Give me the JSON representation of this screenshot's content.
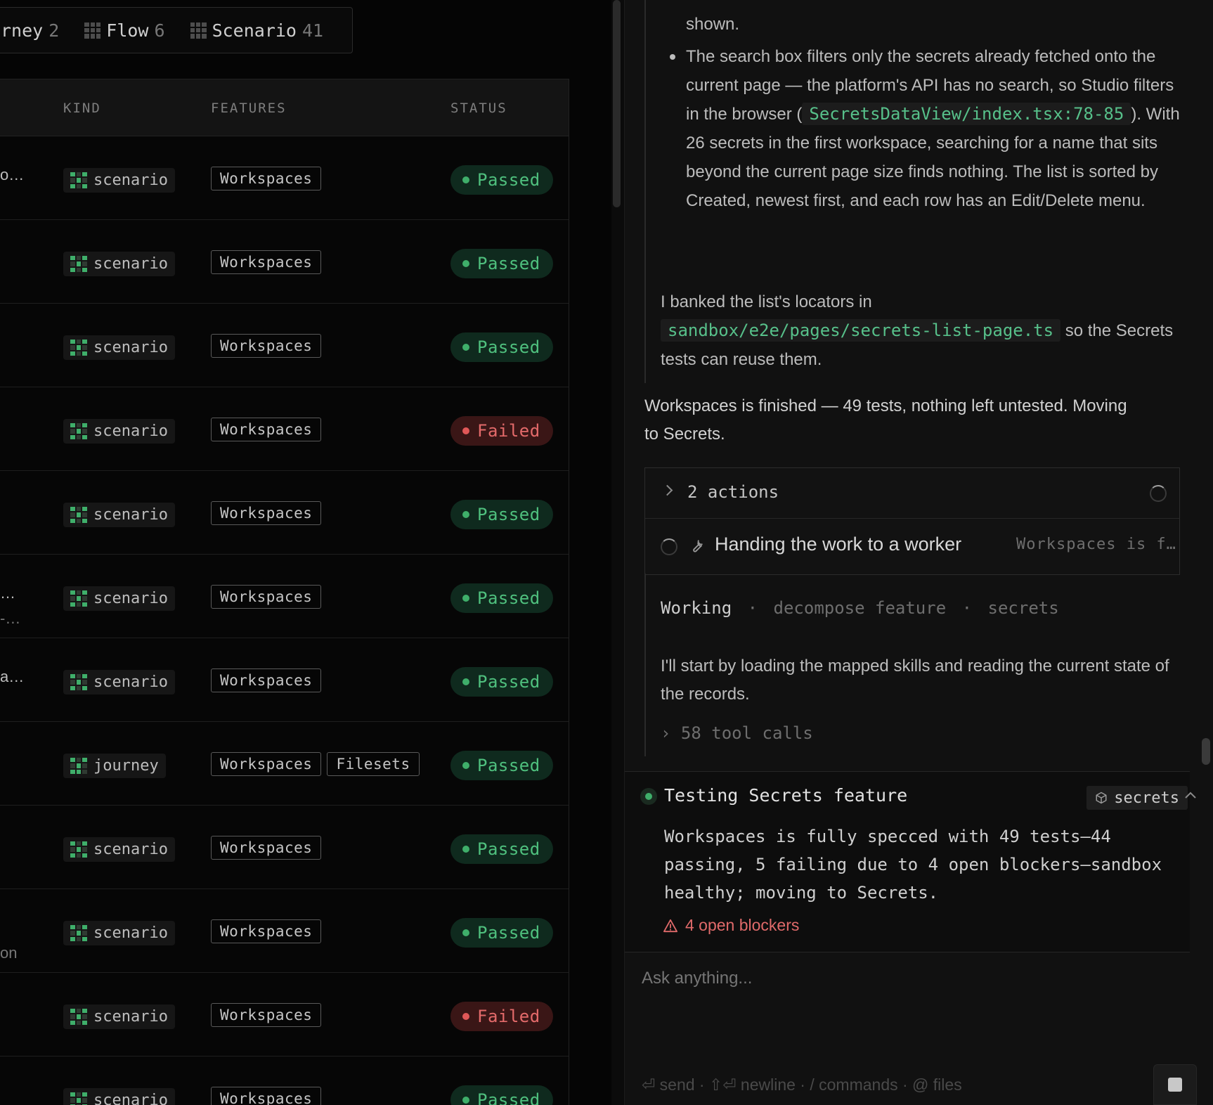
{
  "filter_bar": {
    "chips": [
      {
        "label": "rney",
        "count": "2"
      },
      {
        "label": "Flow",
        "count": "6"
      },
      {
        "label": "Scenario",
        "count": "41"
      }
    ]
  },
  "table": {
    "headers": {
      "kind": "KIND",
      "features": "FEATURES",
      "status": "STATUS"
    },
    "rows": [
      {
        "name": "o…",
        "sub": "",
        "kind": "scenario",
        "features": [
          "Workspaces"
        ],
        "status": "Passed"
      },
      {
        "name": "",
        "sub": "",
        "kind": "scenario",
        "features": [
          "Workspaces"
        ],
        "status": "Passed"
      },
      {
        "name": "",
        "sub": "",
        "kind": "scenario",
        "features": [
          "Workspaces"
        ],
        "status": "Passed"
      },
      {
        "name": "",
        "sub": "",
        "kind": "scenario",
        "features": [
          "Workspaces"
        ],
        "status": "Failed"
      },
      {
        "name": "",
        "sub": "",
        "kind": "scenario",
        "features": [
          "Workspaces"
        ],
        "status": "Passed"
      },
      {
        "name": " …",
        "sub": "-…",
        "kind": "scenario",
        "features": [
          "Workspaces"
        ],
        "status": "Passed"
      },
      {
        "name": "a…",
        "sub": "",
        "kind": "scenario",
        "features": [
          "Workspaces"
        ],
        "status": "Passed"
      },
      {
        "name": "",
        "sub": "",
        "kind": "journey",
        "features": [
          "Workspaces",
          "Filesets"
        ],
        "status": "Passed"
      },
      {
        "name": "",
        "sub": "",
        "kind": "scenario",
        "features": [
          "Workspaces"
        ],
        "status": "Passed"
      },
      {
        "name": "",
        "sub": "on",
        "kind": "scenario",
        "features": [
          "Workspaces"
        ],
        "status": "Passed"
      },
      {
        "name": "",
        "sub": "",
        "kind": "scenario",
        "features": [
          "Workspaces"
        ],
        "status": "Failed"
      },
      {
        "name": "",
        "sub": "",
        "kind": "scenario",
        "features": [
          "Workspaces"
        ],
        "status": "Passed"
      }
    ]
  },
  "chat": {
    "bullet_prev_tail": "shown.",
    "bullet": {
      "part1": "The search box filters only the secrets already fetched onto the current page — the platform's API has no search, so Studio filters in the browser (",
      "code": "SecretsDataView/index.tsx:78-85",
      "part2": "). With 26 secrets in the first workspace, searching for a name that sits beyond the current page size finds nothing. The list is sorted by Created, newest first, and each row has an Edit/Delete menu."
    },
    "banked": {
      "part1": "I banked the list's locators in",
      "code": "sandbox/e2e/pages/secrets-list-page.ts",
      "part2": "so the Secrets tests can reuse them."
    },
    "finished_msg": "Workspaces is finished — 49 tests, nothing left untested. Moving to Secrets.",
    "actions_label": "2 actions",
    "handoff_title": "Handing the work to a worker",
    "handoff_preview": "Workspaces is f…",
    "working": {
      "label": "Working",
      "sep": "·",
      "step": "decompose feature",
      "target": "secrets"
    },
    "worker_msg": "I'll start by loading the mapped skills and reading the current state of the records.",
    "tool_calls": "58 tool calls"
  },
  "status_card": {
    "title": "Testing Secrets feature",
    "chip": "secrets",
    "summary": "Workspaces is fully specced with 49 tests—44 passing, 5 failing due to 4 open blockers—sandbox healthy; moving to Secrets.",
    "blockers": "4 open blockers"
  },
  "input": {
    "placeholder": "Ask anything...",
    "hints": "⏎ send · ⇧⏎ newline · / commands · @ files"
  },
  "colors": {
    "passed": "#4fc07e",
    "failed": "#e36a6a",
    "code": "#57c08a",
    "warning": "#e06a6a"
  }
}
